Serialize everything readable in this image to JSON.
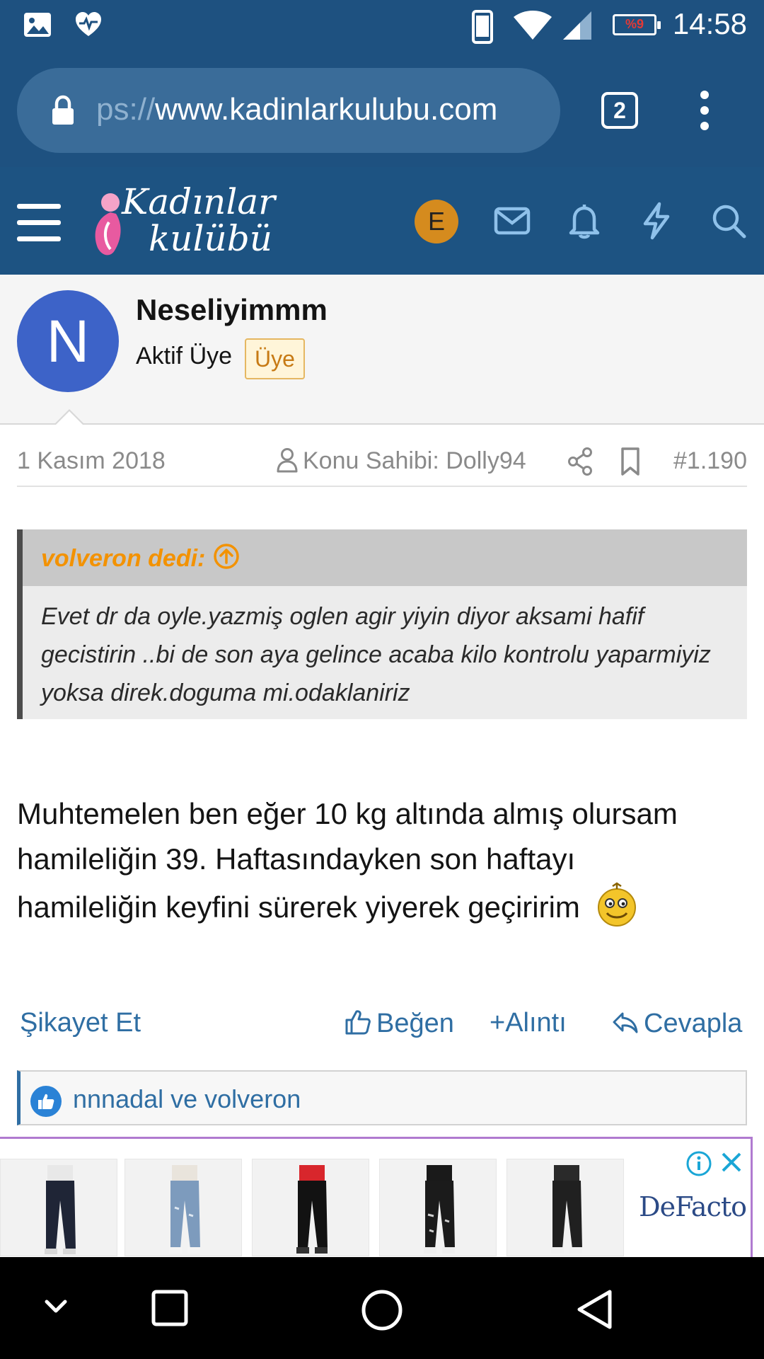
{
  "status_bar": {
    "time": "14:58",
    "battery_text": "%9",
    "icons": [
      "image-icon",
      "heart-pulse-icon",
      "phone-icon",
      "wifi-icon",
      "signal-icon",
      "battery-icon"
    ]
  },
  "browser": {
    "url_prefix": "ps://",
    "url_domain": "www.kadinlarkulubu.com",
    "tab_count": "2"
  },
  "site_header": {
    "logo_line1": "Kadınlar",
    "logo_line2": "kulübü",
    "user_initial": "E",
    "icons": [
      "menu-icon",
      "mail-icon",
      "bell-icon",
      "bolt-icon",
      "search-icon"
    ]
  },
  "post": {
    "avatar_letter": "N",
    "username": "Neseliyimmm",
    "user_title": "Aktif Üye",
    "badge": "Üye",
    "date": "1 Kasım 2018",
    "thread_owner": "Konu Sahibi: Dolly94",
    "post_number": "#1.190",
    "quote": {
      "author": "volveron dedi:",
      "text": "Evet dr da oyle.yazmiş oglen agir yiyin diyor aksami hafif gecistirin ..bi de son aya gelince acaba kilo kontrolu yaparmiyiz yoksa direk.doguma mi.odaklaniriz"
    },
    "body_line1": "Muhtemelen ben eğer 10 kg altında almış olursam hamileliğin 39. Haftasındayken son haftayı",
    "body_line2": "hamileliğin keyfini sürerek yiyerek geçiririm",
    "actions": {
      "report": "Şikayet Et",
      "like": "Beğen",
      "quote": "Alıntı",
      "reply": "Cevapla"
    },
    "reactions_text": "nnnadal ve volveron"
  },
  "ad": {
    "brand": "DeFacto",
    "item_count": 5
  },
  "nav_bar": {
    "buttons": [
      "collapse-button",
      "recents-button",
      "home-button",
      "back-button"
    ]
  },
  "colors": {
    "header_blue": "#1d5382",
    "link_blue": "#2f6ea3",
    "quote_orange": "#f39200",
    "avatar_blue": "#3d63c8",
    "user_avatar_orange": "#d58b1e"
  }
}
